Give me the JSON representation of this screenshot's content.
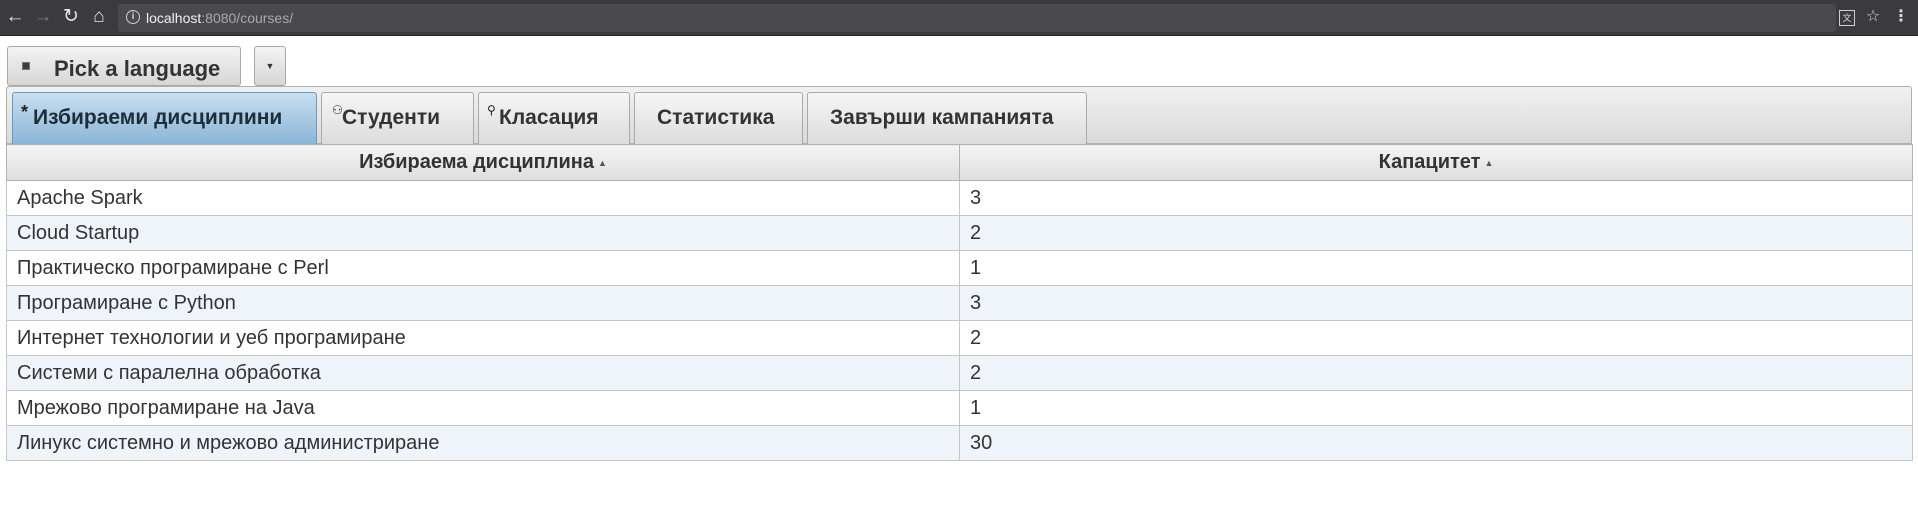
{
  "browser": {
    "url_host": "localhost",
    "url_rest": ":8080/courses/",
    "icons": {
      "back": "arrow-left",
      "forward": "arrow-right",
      "reload": "reload",
      "home": "home",
      "info": "info",
      "translate": "translate",
      "bookmark": "star",
      "menu": "vertical-ellipsis"
    }
  },
  "language_picker": {
    "label": "Pick a language",
    "dropdown_icon": "caret-down"
  },
  "tabs": [
    {
      "label": "Избираеми дисциплини",
      "icon": "asterisk",
      "active": true
    },
    {
      "label": "Студенти",
      "icon": "person",
      "active": false
    },
    {
      "label": "Класация",
      "icon": "magnifier",
      "active": false
    },
    {
      "label": "Статистика",
      "icon": "",
      "active": false
    },
    {
      "label": "Завърши кампанията",
      "icon": "",
      "active": false
    }
  ],
  "table": {
    "columns": [
      {
        "header": "Избираема дисциплина",
        "sortable": true
      },
      {
        "header": "Капацитет",
        "sortable": true
      }
    ],
    "rows": [
      {
        "course": "Apache Spark",
        "capacity": "3"
      },
      {
        "course": "Cloud Startup",
        "capacity": "2"
      },
      {
        "course": "Практическо програмиране с Perl",
        "capacity": "1"
      },
      {
        "course": "Програмиране с Python",
        "capacity": "3"
      },
      {
        "course": "Интернет технологии и уеб програмиране",
        "capacity": "2"
      },
      {
        "course": "Системи с паралелна обработка",
        "capacity": "2"
      },
      {
        "course": "Мрежово програмиране на Java",
        "capacity": "1"
      },
      {
        "course": "Линукс системно и мрежово администриране",
        "capacity": "30"
      }
    ]
  },
  "colors": {
    "active_tab": "#8ab5d6",
    "row_alt": "#eff4fa",
    "chrome": "#3b3b3d"
  }
}
